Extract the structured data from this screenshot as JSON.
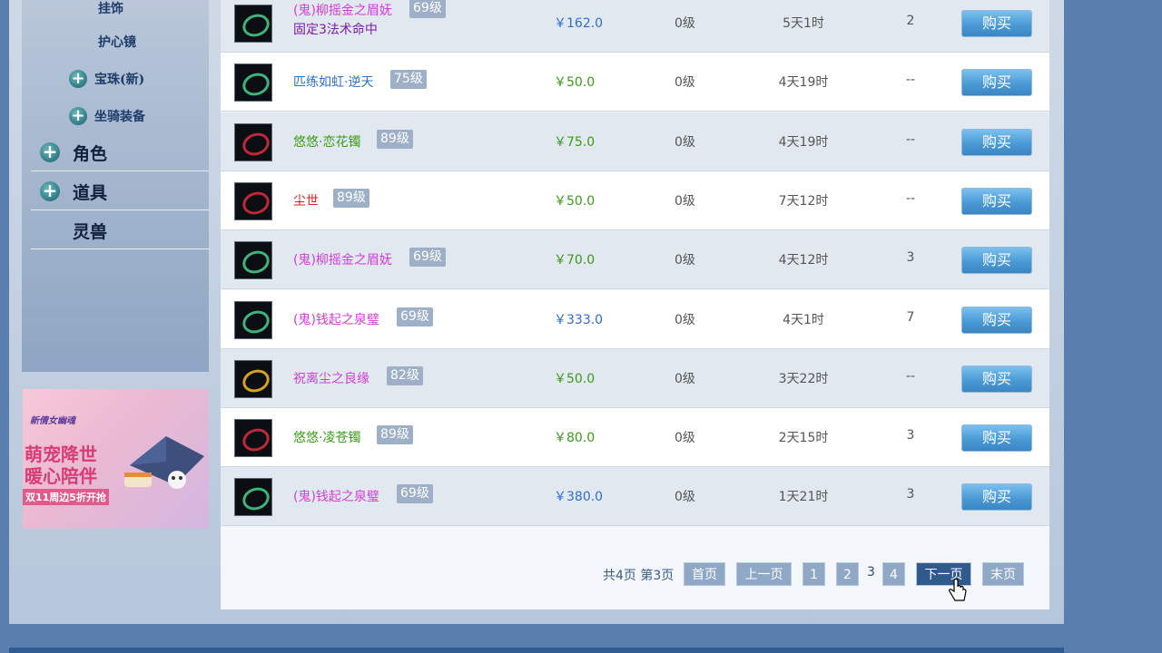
{
  "sidebar": {
    "sub_items": [
      {
        "label": "挂饰"
      },
      {
        "label": "护心镜"
      },
      {
        "label": "宝珠(新)"
      },
      {
        "label": "坐骑装备"
      }
    ],
    "main_items": [
      {
        "label": "角色"
      },
      {
        "label": "道具"
      },
      {
        "label": "灵兽"
      }
    ]
  },
  "banner": {
    "title": "新倩女幽魂",
    "line1": "萌宠降世",
    "line2": "暖心陪伴",
    "line3": "双11周边5折开抢"
  },
  "listings": [
    {
      "name": "(鬼)柳摇金之眉妩",
      "level": "69级",
      "sub": "固定3法术命中",
      "price": "￥162.0",
      "req": "0级",
      "time": "5天1时",
      "count": "2",
      "buy": "购买",
      "name_color": "#d23ed1",
      "price_color": "#2f6ed0"
    },
    {
      "name": "匹练如虹·逆天",
      "level": "75级",
      "sub": "",
      "price": "￥50.0",
      "req": "0级",
      "time": "4天19时",
      "count": "--",
      "buy": "购买",
      "name_color": "#2e72c9",
      "price_color": "#3a9a18"
    },
    {
      "name": "悠悠·恋花镯",
      "level": "89级",
      "sub": "",
      "price": "￥75.0",
      "req": "0级",
      "time": "4天19时",
      "count": "--",
      "buy": "购买",
      "name_color": "#3a9a18",
      "price_color": "#3a9a18"
    },
    {
      "name": "尘世",
      "level": "89级",
      "sub": "",
      "price": "￥50.0",
      "req": "0级",
      "time": "7天12时",
      "count": "--",
      "buy": "购买",
      "name_color": "#e01e1e",
      "price_color": "#3a9a18"
    },
    {
      "name": "(鬼)柳摇金之眉妩",
      "level": "69级",
      "sub": "",
      "price": "￥70.0",
      "req": "0级",
      "time": "4天12时",
      "count": "3",
      "buy": "购买",
      "name_color": "#d23ed1",
      "price_color": "#3a9a18"
    },
    {
      "name": "(鬼)钱起之泉璧",
      "level": "69级",
      "sub": "",
      "price": "￥333.0",
      "req": "0级",
      "time": "4天1时",
      "count": "7",
      "buy": "购买",
      "name_color": "#d23ed1",
      "price_color": "#2f6ed0"
    },
    {
      "name": "祝离尘之良缘",
      "level": "82级",
      "sub": "",
      "price": "￥50.0",
      "req": "0级",
      "time": "3天22时",
      "count": "--",
      "buy": "购买",
      "name_color": "#d23ed1",
      "price_color": "#3a9a18"
    },
    {
      "name": "悠悠·凌苍镯",
      "level": "89级",
      "sub": "",
      "price": "￥80.0",
      "req": "0级",
      "time": "2天15时",
      "count": "3",
      "buy": "购买",
      "name_color": "#3a9a18",
      "price_color": "#3a9a18"
    },
    {
      "name": "(鬼)钱起之泉璧",
      "level": "69级",
      "sub": "",
      "price": "￥380.0",
      "req": "0级",
      "time": "1天21时",
      "count": "3",
      "buy": "购买",
      "name_color": "#d23ed1",
      "price_color": "#2f6ed0"
    }
  ],
  "pagination": {
    "info": "共4页 第3页",
    "first": "首页",
    "prev": "上一页",
    "pages": [
      "1",
      "2",
      "3",
      "4"
    ],
    "current": "3",
    "next": "下一页",
    "last": "末页"
  }
}
